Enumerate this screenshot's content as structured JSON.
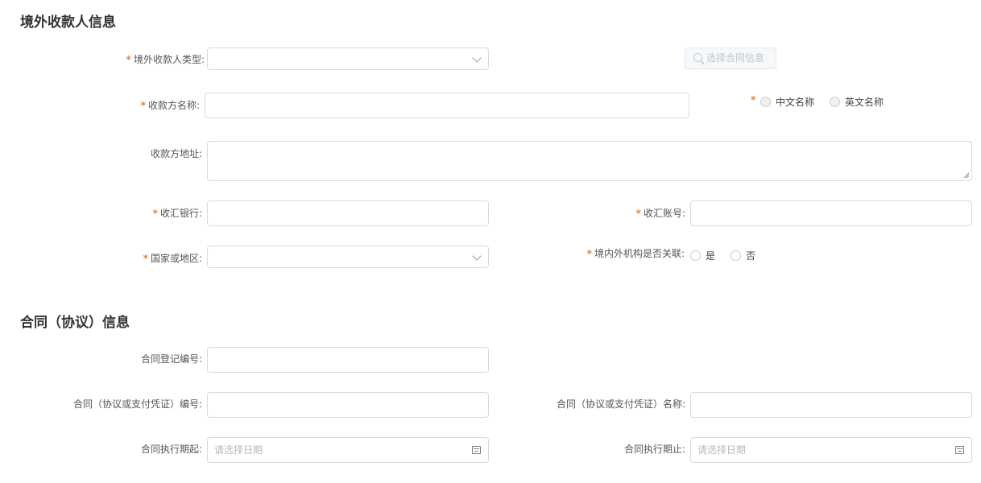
{
  "sections": {
    "payee": {
      "title": "境外收款人信息"
    },
    "contract": {
      "title": "合同（协议）信息"
    }
  },
  "payee": {
    "type_label": "境外收款人类型:",
    "select_contract_button": "选择合同信息",
    "name_label": "收款方名称:",
    "name_lang_options": [
      "中文名称",
      "英文名称"
    ],
    "address_label": "收款方地址:",
    "bank_label": "收汇银行:",
    "account_label": "收汇账号:",
    "country_label": "国家或地区:",
    "related_label": "境内外机构是否关联:",
    "related_options": [
      "是",
      "否"
    ]
  },
  "contract": {
    "reg_no_label": "合同登记编号:",
    "no_label": "合同（协议或支付凭证）编号:",
    "name_label": "合同（协议或支付凭证）名称:",
    "start_label": "合同执行期起:",
    "end_label": "合同执行期止:",
    "date_placeholder": "请选择日期"
  },
  "colors": {
    "required_star": "#e6813a",
    "border": "#d7dae0"
  }
}
